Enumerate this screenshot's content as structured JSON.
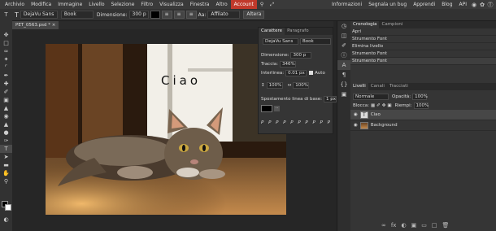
{
  "menu": {
    "items": [
      "Archivio",
      "Modifica",
      "Immagine",
      "Livello",
      "Selezione",
      "Filtro",
      "Visualizza",
      "Finestra",
      "Altro",
      "Account"
    ],
    "right_items": [
      "Informazioni",
      "Segnala un bug",
      "Apprendi",
      "Blog",
      "API"
    ]
  },
  "options": {
    "font": "DejaVu Sans",
    "style": "Book",
    "size_label": "Dimensione:",
    "size_value": "300 p",
    "aa_label": "Aa:",
    "aa_value": "Affilato",
    "altera": "Altera"
  },
  "document": {
    "tab": "PET_0563.psd *",
    "text_layer": "Ciao"
  },
  "character_panel": {
    "tabs": [
      "Carattere",
      "Paragrafo"
    ],
    "font": "DejaVu Sans",
    "style": "Book",
    "size_label": "Dimensione:",
    "size_value": "300 p",
    "tracking_label": "Traccia:",
    "tracking_value": "346%",
    "leading_label": "Interlinea:",
    "leading_value": "0.01 px",
    "auto_label": "Auto",
    "vscale": "100%",
    "hscale": "100%",
    "baseline_label": "Spostamento linea di base:",
    "baseline_value": "1 px",
    "style_buttons": [
      "P",
      "P",
      "P",
      "P",
      "P",
      "P",
      "P",
      "P",
      "P",
      "P"
    ]
  },
  "history_panel": {
    "tabs": [
      "Cronologia",
      "Campioni"
    ],
    "items": [
      "Apri",
      "Strumento Font",
      "Elimina livello",
      "Strumento Font",
      "Strumento Font"
    ]
  },
  "layers_panel": {
    "tabs": [
      "Livelli",
      "Canali",
      "Tracciati"
    ],
    "blend_mode": "Normale",
    "opacity_label": "Opacità:",
    "opacity_value": "100%",
    "lock_label": "Blocca:",
    "fill_label": "Riempi:",
    "fill_value": "100%",
    "layers": [
      {
        "name": "Ciao",
        "type": "text"
      },
      {
        "name": "Background",
        "type": "image"
      }
    ]
  },
  "colors": {
    "accent": "#c0392b",
    "bg": "#262626",
    "panel": "#353535"
  }
}
